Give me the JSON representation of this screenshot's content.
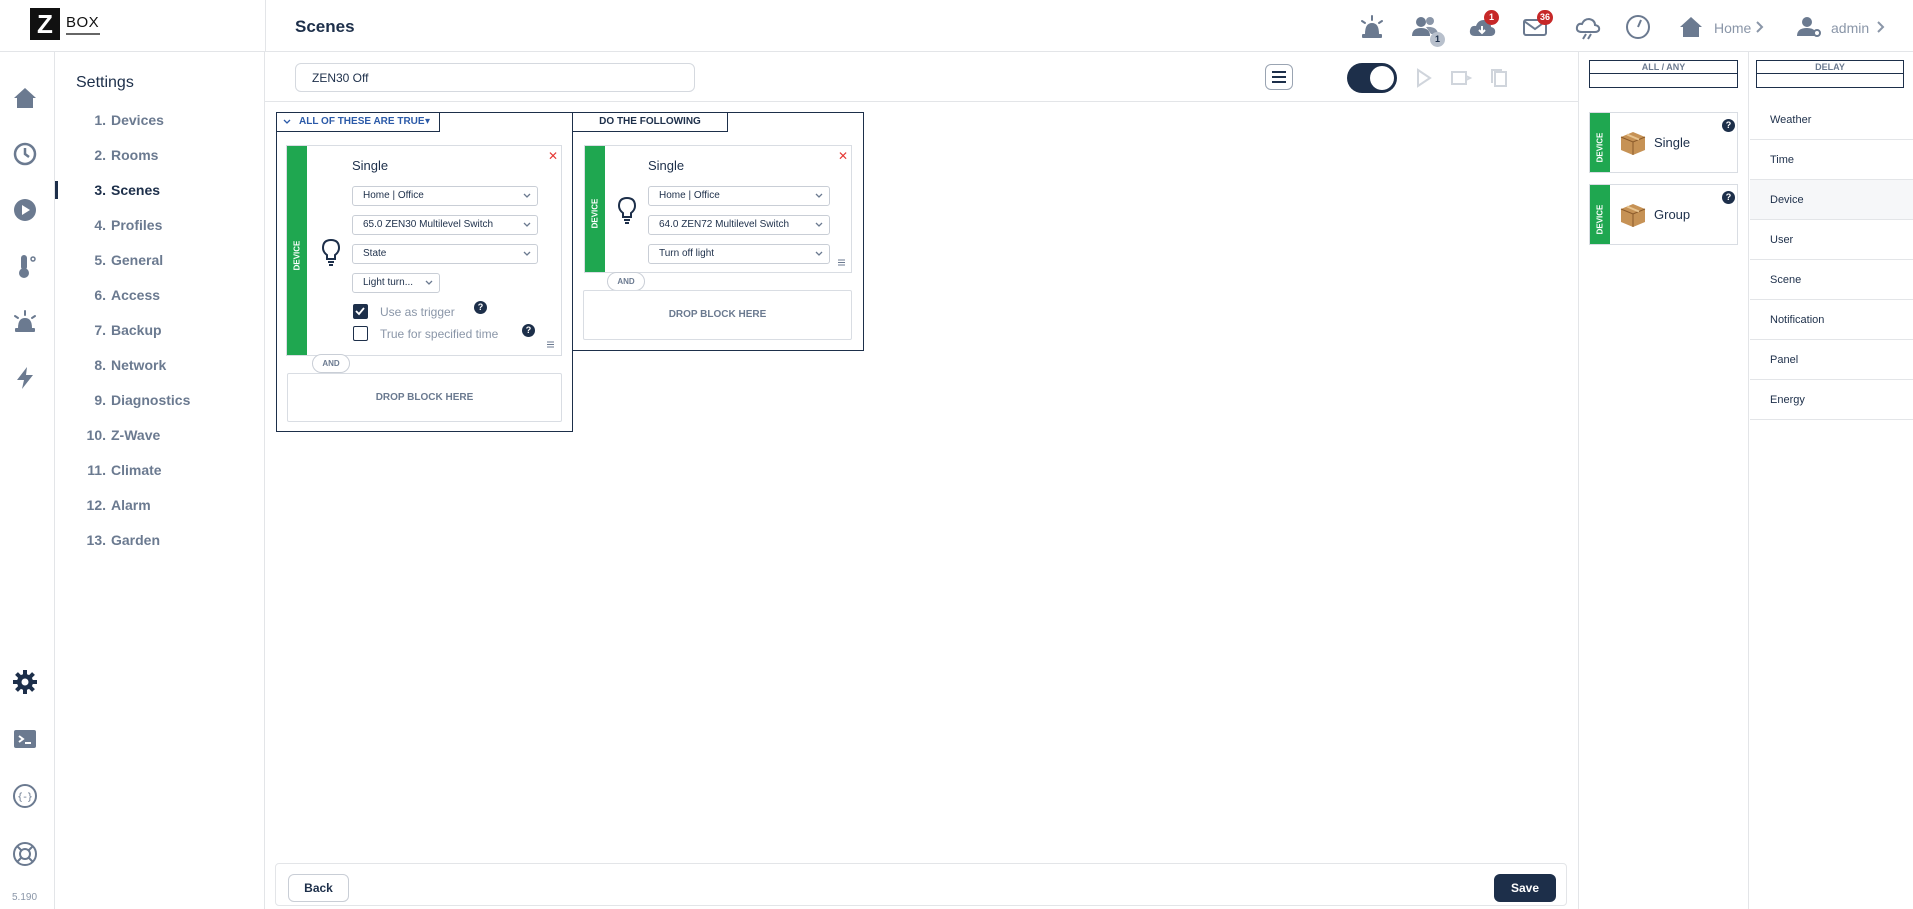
{
  "app": {
    "logo_text": "BOX",
    "logo_letter": "Z",
    "version": "5.190"
  },
  "header": {
    "page_title": "Scenes",
    "alerts_count": "1",
    "downloads_count": "1",
    "messages_count": "36",
    "home_label": "Home",
    "user_label": "admin"
  },
  "menu": {
    "title": "Settings",
    "items": [
      {
        "num": "1.",
        "label": "Devices"
      },
      {
        "num": "2.",
        "label": "Rooms"
      },
      {
        "num": "3.",
        "label": "Scenes"
      },
      {
        "num": "4.",
        "label": "Profiles"
      },
      {
        "num": "5.",
        "label": "General"
      },
      {
        "num": "6.",
        "label": "Access"
      },
      {
        "num": "7.",
        "label": "Backup"
      },
      {
        "num": "8.",
        "label": "Network"
      },
      {
        "num": "9.",
        "label": "Diagnostics"
      },
      {
        "num": "10.",
        "label": "Z-Wave"
      },
      {
        "num": "11.",
        "label": "Climate"
      },
      {
        "num": "12.",
        "label": "Alarm"
      },
      {
        "num": "13.",
        "label": "Garden"
      }
    ],
    "active_index": 2
  },
  "scene": {
    "name": "ZEN30 Off",
    "enabled": true,
    "conditions": {
      "header": "ALL OF THESE ARE TRUE",
      "card": {
        "stripe": "DEVICE",
        "title": "Single",
        "room": "Home | Office",
        "device": "65.0 ZEN30 Multilevel Switch",
        "property": "State",
        "value": "Light turn...",
        "use_as_trigger_label": "Use as trigger",
        "use_as_trigger_checked": true,
        "true_for_time_label": "True for specified time",
        "true_for_time_checked": false,
        "help": "?"
      },
      "and_label": "AND",
      "drop_label": "DROP BLOCK HERE"
    },
    "actions": {
      "header": "DO THE FOLLOWING",
      "card": {
        "stripe": "DEVICE",
        "title": "Single",
        "room": "Home | Office",
        "device": "64.0 ZEN72 Multilevel Switch",
        "action": "Turn off light"
      },
      "and_label": "AND",
      "drop_label": "DROP BLOCK HERE"
    }
  },
  "footer": {
    "back_label": "Back",
    "save_label": "Save"
  },
  "right_panel": {
    "all_any_label": "ALL / ANY",
    "delay_label": "DELAY",
    "blocks": [
      {
        "stripe": "DEVICE",
        "label": "Single",
        "help": "?"
      },
      {
        "stripe": "DEVICE",
        "label": "Group",
        "help": "?"
      }
    ],
    "categories": [
      "Weather",
      "Time",
      "Device",
      "User",
      "Scene",
      "Notification",
      "Panel",
      "Energy"
    ],
    "selected_category": "Device"
  },
  "colors": {
    "navy": "#1d2f4a",
    "green": "#1fa750",
    "badge_red": "#c62828",
    "close_red": "#e53935"
  }
}
